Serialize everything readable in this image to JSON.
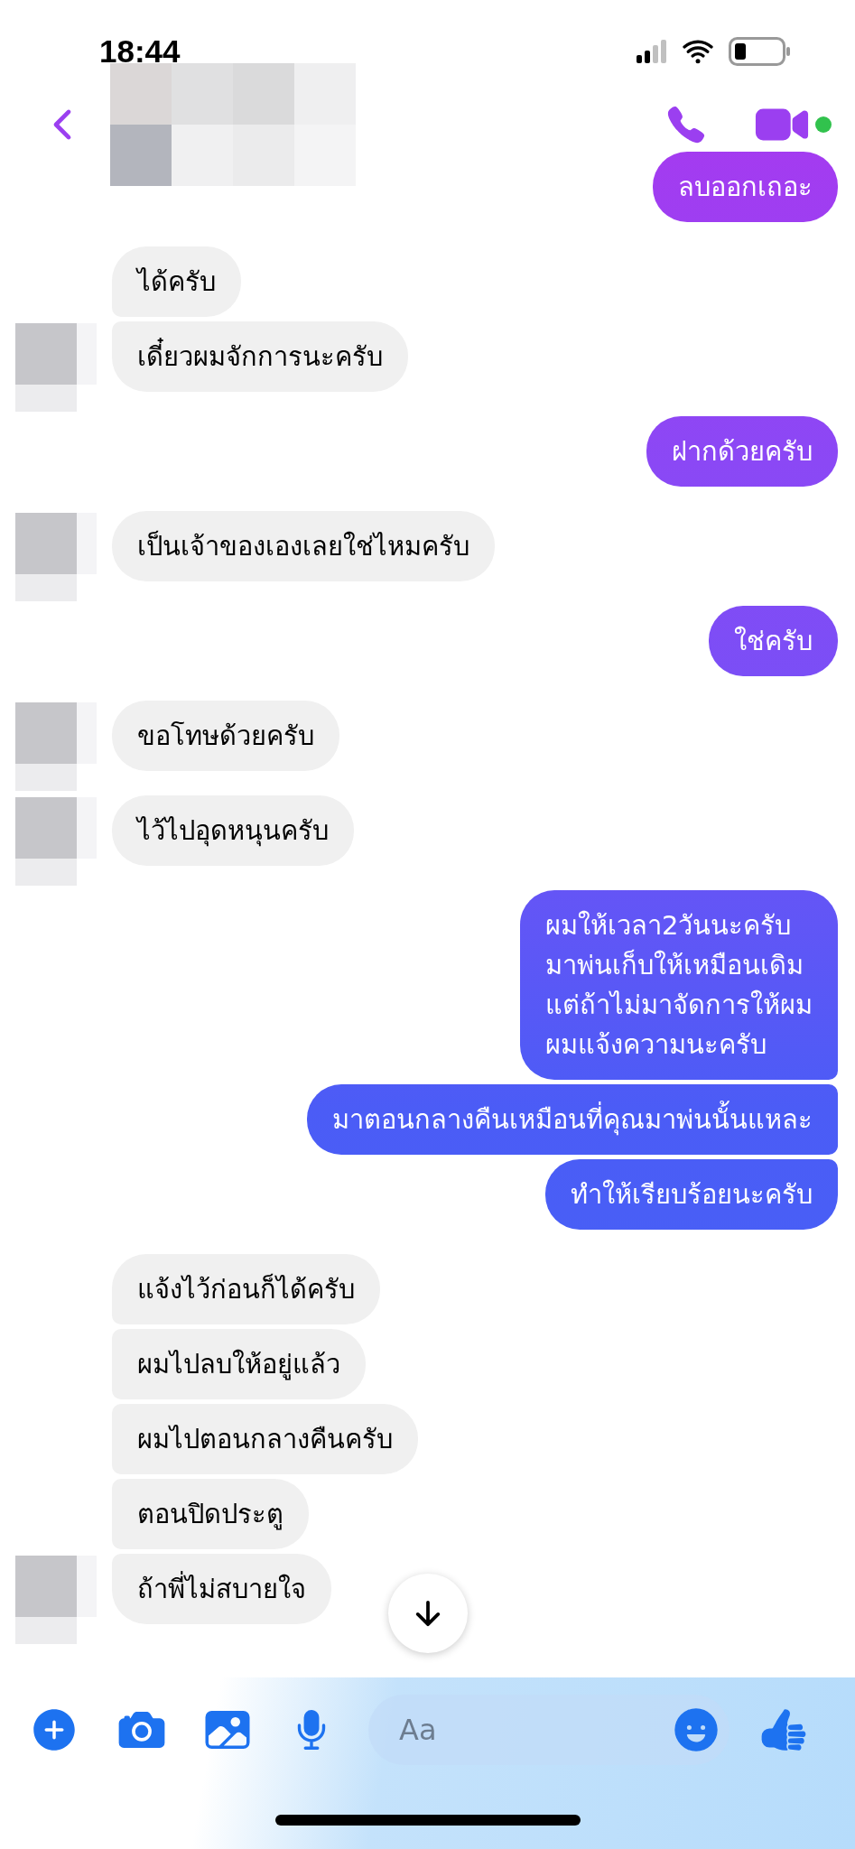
{
  "status_bar": {
    "time": "18:44"
  },
  "composer": {
    "placeholder": "Aa"
  },
  "messages": [
    {
      "kind": "sent",
      "text": "ลบออกเถอะ"
    },
    {
      "kind": "received",
      "text": "ได้ครับ",
      "avatar": false
    },
    {
      "kind": "received",
      "text": "เดี๋ยวผมจักการนะครับ",
      "avatar": true
    },
    {
      "kind": "sent",
      "text": "ฝากด้วยครับ"
    },
    {
      "kind": "received",
      "text": "เป็นเจ้าของเองเลยใช่ไหมครับ",
      "avatar": true
    },
    {
      "kind": "sent",
      "text": "ใช่ครับ"
    },
    {
      "kind": "received",
      "text": "ขอโทษด้วยครับ",
      "avatar": true
    },
    {
      "kind": "received",
      "text": "ไว้ไปอุดหนุนครับ",
      "avatar": true
    },
    {
      "kind": "sent",
      "text": "ผมให้เวลา2วันนะครับ\nมาพ่นเก็บให้เหมือนเดิม\nแต่ถ้าไม่มาจัดการให้ผม\nผมแจ้งความนะครับ"
    },
    {
      "kind": "sent",
      "text": "มาตอนกลางคืนเหมือนที่คุณมาพ่นนั้นแหละ"
    },
    {
      "kind": "sent",
      "text": "ทำให้เรียบร้อยนะครับ"
    },
    {
      "kind": "received",
      "text": "แจ้งไว้ก่อนก็ได้ครับ",
      "avatar": false
    },
    {
      "kind": "received",
      "text": "ผมไปลบให้อยู่แล้ว",
      "avatar": false
    },
    {
      "kind": "received",
      "text": "ผมไปตอนกลางคืนครับ",
      "avatar": false
    },
    {
      "kind": "received",
      "text": "ตอนปิดประตู",
      "avatar": false
    },
    {
      "kind": "received",
      "text": "ถ้าพี่ไม่สบายใจ",
      "avatar": true
    }
  ]
}
